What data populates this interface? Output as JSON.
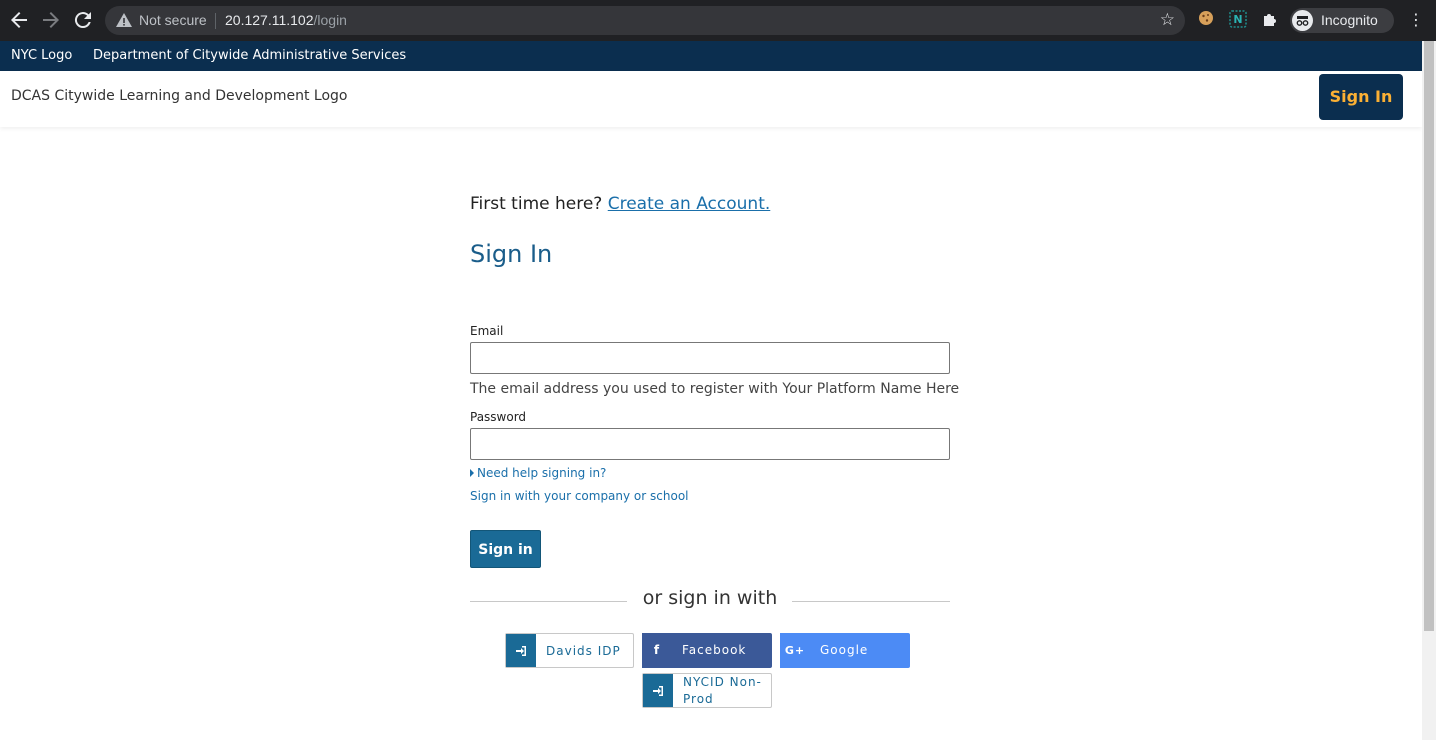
{
  "browser": {
    "omnibox": {
      "security_label": "Not secure",
      "url_host": "20.127.11.102",
      "url_path": "/login"
    },
    "profile_label": "Incognito"
  },
  "gov_bar": {
    "logo_alt": "NYC Logo",
    "title": "Department of Citywide Administrative Services"
  },
  "header": {
    "logo_alt": "DCAS Citywide Learning and Development Logo",
    "signin_label": "Sign In"
  },
  "login": {
    "first_time_text": "First time here?",
    "create_account_link": "Create an Account.",
    "title": "Sign In",
    "email_label": "Email",
    "email_value": "",
    "email_help": "The email address you used to register with Your Platform Name Here",
    "password_label": "Password",
    "password_value": "",
    "need_help_link": "Need help signing in?",
    "company_link": "Sign in with your company or school",
    "submit_label": "Sign in",
    "or_text": "or sign in with"
  },
  "social": [
    {
      "label": "Davids IDP",
      "icon": "sign-in-icon"
    },
    {
      "label": "Facebook",
      "icon": "facebook-icon"
    },
    {
      "label": "Google",
      "icon": "google-plus-icon"
    },
    {
      "label": "NYCID Non-Prod",
      "icon": "sign-in-icon"
    }
  ],
  "colors": {
    "gov_bar": "#0b2e4f",
    "header_button_text": "#fbb034",
    "primary": "#1a6a96",
    "facebook": "#3b5998",
    "google": "#4c8bf5"
  }
}
